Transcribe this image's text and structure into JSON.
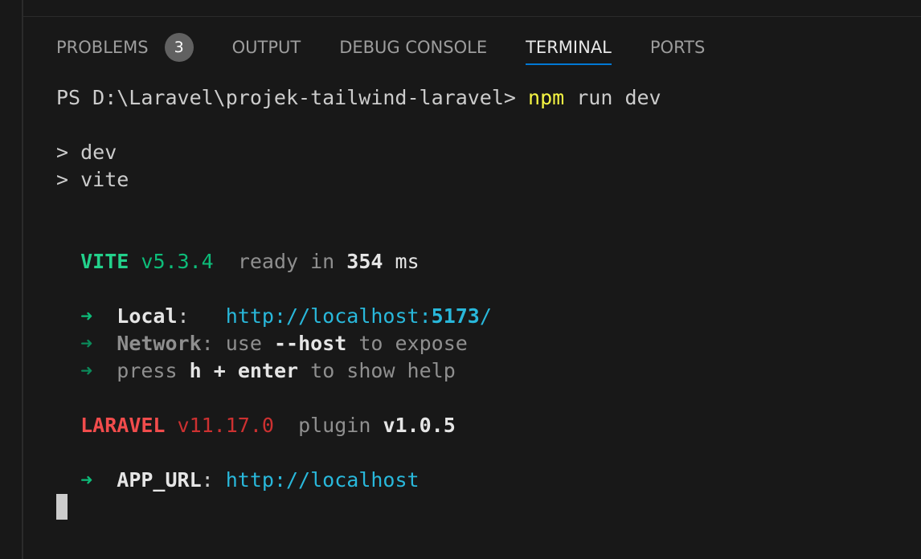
{
  "tabs": [
    {
      "label": "PROBLEMS",
      "badge": "3"
    },
    {
      "label": "OUTPUT"
    },
    {
      "label": "DEBUG CONSOLE"
    },
    {
      "label": "TERMINAL",
      "active": true
    },
    {
      "label": "PORTS"
    }
  ],
  "terminal": {
    "prompt": "PS D:\\Laravel\\projek-tailwind-laravel>",
    "command_bin": "npm",
    "command_args": "run dev",
    "script_lines": [
      "> dev",
      "> vite"
    ],
    "vite": {
      "name": "VITE",
      "version": "v5.3.4",
      "ready_text": "ready in",
      "ready_ms": "354",
      "ms_unit": "ms",
      "arrow": "➜",
      "local_label": "Local",
      "local_url_prefix": "http://localhost:",
      "local_port": "5173",
      "local_url_suffix": "/",
      "network_label": "Network",
      "network_use": "use",
      "network_flag": "--host",
      "network_rest": "to expose",
      "press_text": "press",
      "press_key": "h + enter",
      "press_rest": "to show help"
    },
    "laravel": {
      "name": "LARAVEL",
      "version": "v11.17.0",
      "plugin_text": "plugin",
      "plugin_version": "v1.0.5",
      "app_url_label": "APP_URL",
      "app_url": "http://localhost"
    }
  }
}
